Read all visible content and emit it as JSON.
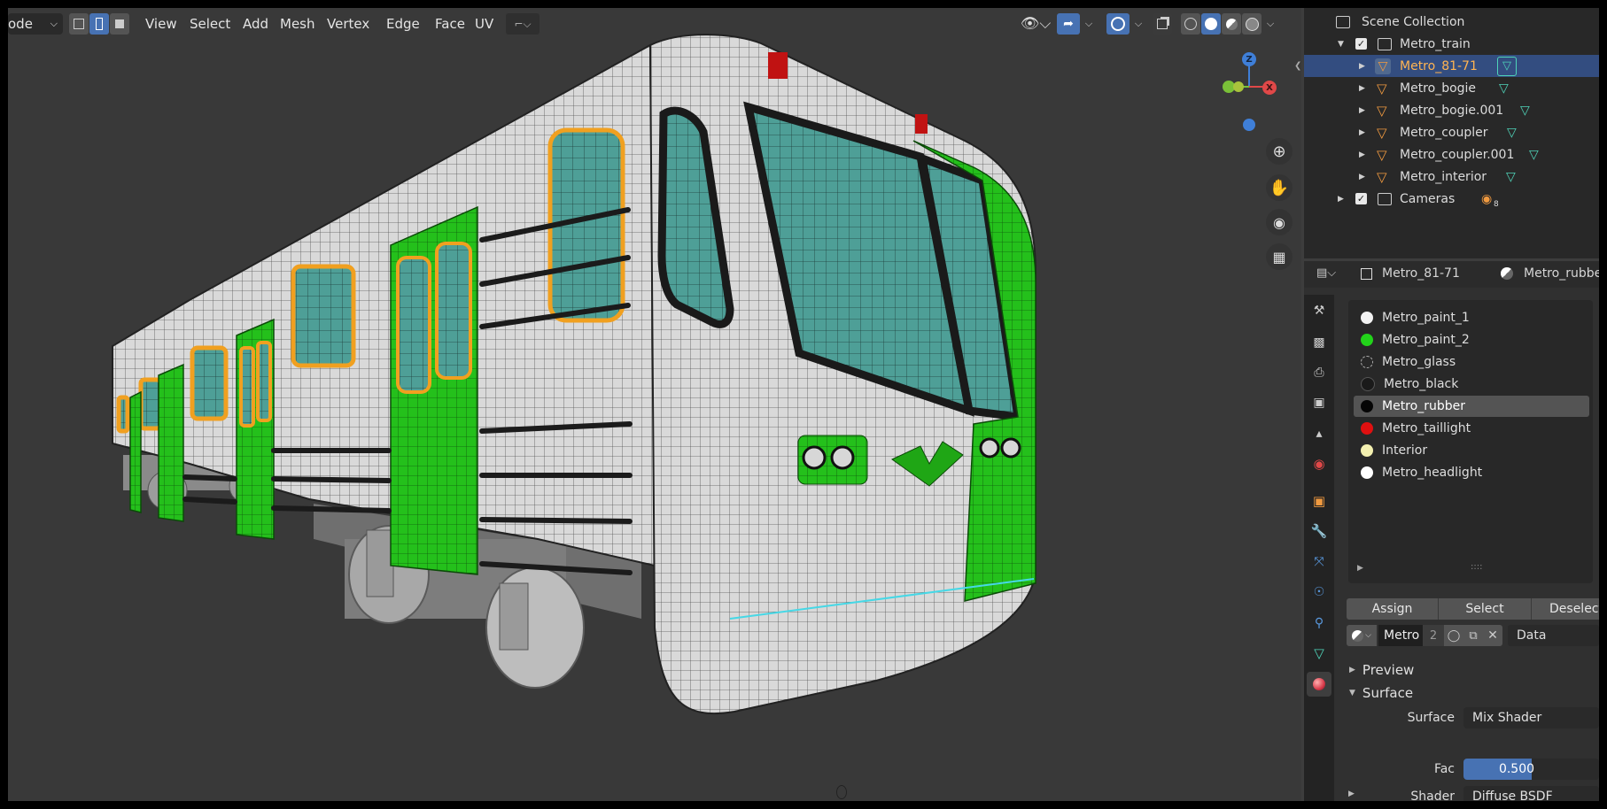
{
  "header": {
    "mode_label": "ode",
    "menus": [
      "View",
      "Select",
      "Add",
      "Mesh",
      "Vertex",
      "Edge",
      "Face",
      "UV"
    ]
  },
  "outliner": {
    "root": "Scene Collection",
    "items": [
      {
        "label": "Metro_train",
        "type": "collection"
      },
      {
        "label": "Metro_81-71",
        "type": "mesh",
        "selected": true
      },
      {
        "label": "Metro_bogie",
        "type": "mesh"
      },
      {
        "label": "Metro_bogie.001",
        "type": "mesh"
      },
      {
        "label": "Metro_coupler",
        "type": "mesh"
      },
      {
        "label": "Metro_coupler.001",
        "type": "mesh"
      },
      {
        "label": "Metro_interior",
        "type": "mesh"
      },
      {
        "label": "Cameras",
        "type": "collection"
      }
    ],
    "cameras_count": "8"
  },
  "properties": {
    "object_name": "Metro_81-71",
    "material_name": "Metro_rubber",
    "slots": [
      {
        "label": "Metro_paint_1",
        "color": "#f2f2f2"
      },
      {
        "label": "Metro_paint_2",
        "color": "#22d31a"
      },
      {
        "label": "Metro_glass",
        "color": "#777777"
      },
      {
        "label": "Metro_black",
        "color": "#1a1a1a"
      },
      {
        "label": "Metro_rubber",
        "color": "#050505",
        "selected": true
      },
      {
        "label": "Metro_taillight",
        "color": "#e01010"
      },
      {
        "label": "Interior",
        "color": "#f3f0b0"
      },
      {
        "label": "Metro_headlight",
        "color": "#ffffff"
      }
    ],
    "buttons": {
      "assign": "Assign",
      "select": "Select",
      "deselect": "Deselect"
    },
    "datablock": {
      "name": "Metro",
      "users": "2",
      "link": "Data"
    },
    "sections": {
      "preview": "Preview",
      "surface": "Surface"
    },
    "fields": {
      "surface_label": "Surface",
      "surface_value": "Mix Shader",
      "fac_label": "Fac",
      "fac_value": "0.500",
      "fac_fraction": 0.5,
      "shader_label": "Shader",
      "shader_value": "Diffuse BSDF"
    }
  },
  "gizmo": {
    "z": "Z",
    "x": "X"
  },
  "colors": {
    "accent": "#4772b3",
    "selected_row": "#334d80",
    "selected_text": "#ffb452",
    "paint_green": "#22c01a",
    "window_frame": "#f0a020",
    "glass": "#4fa39a"
  }
}
